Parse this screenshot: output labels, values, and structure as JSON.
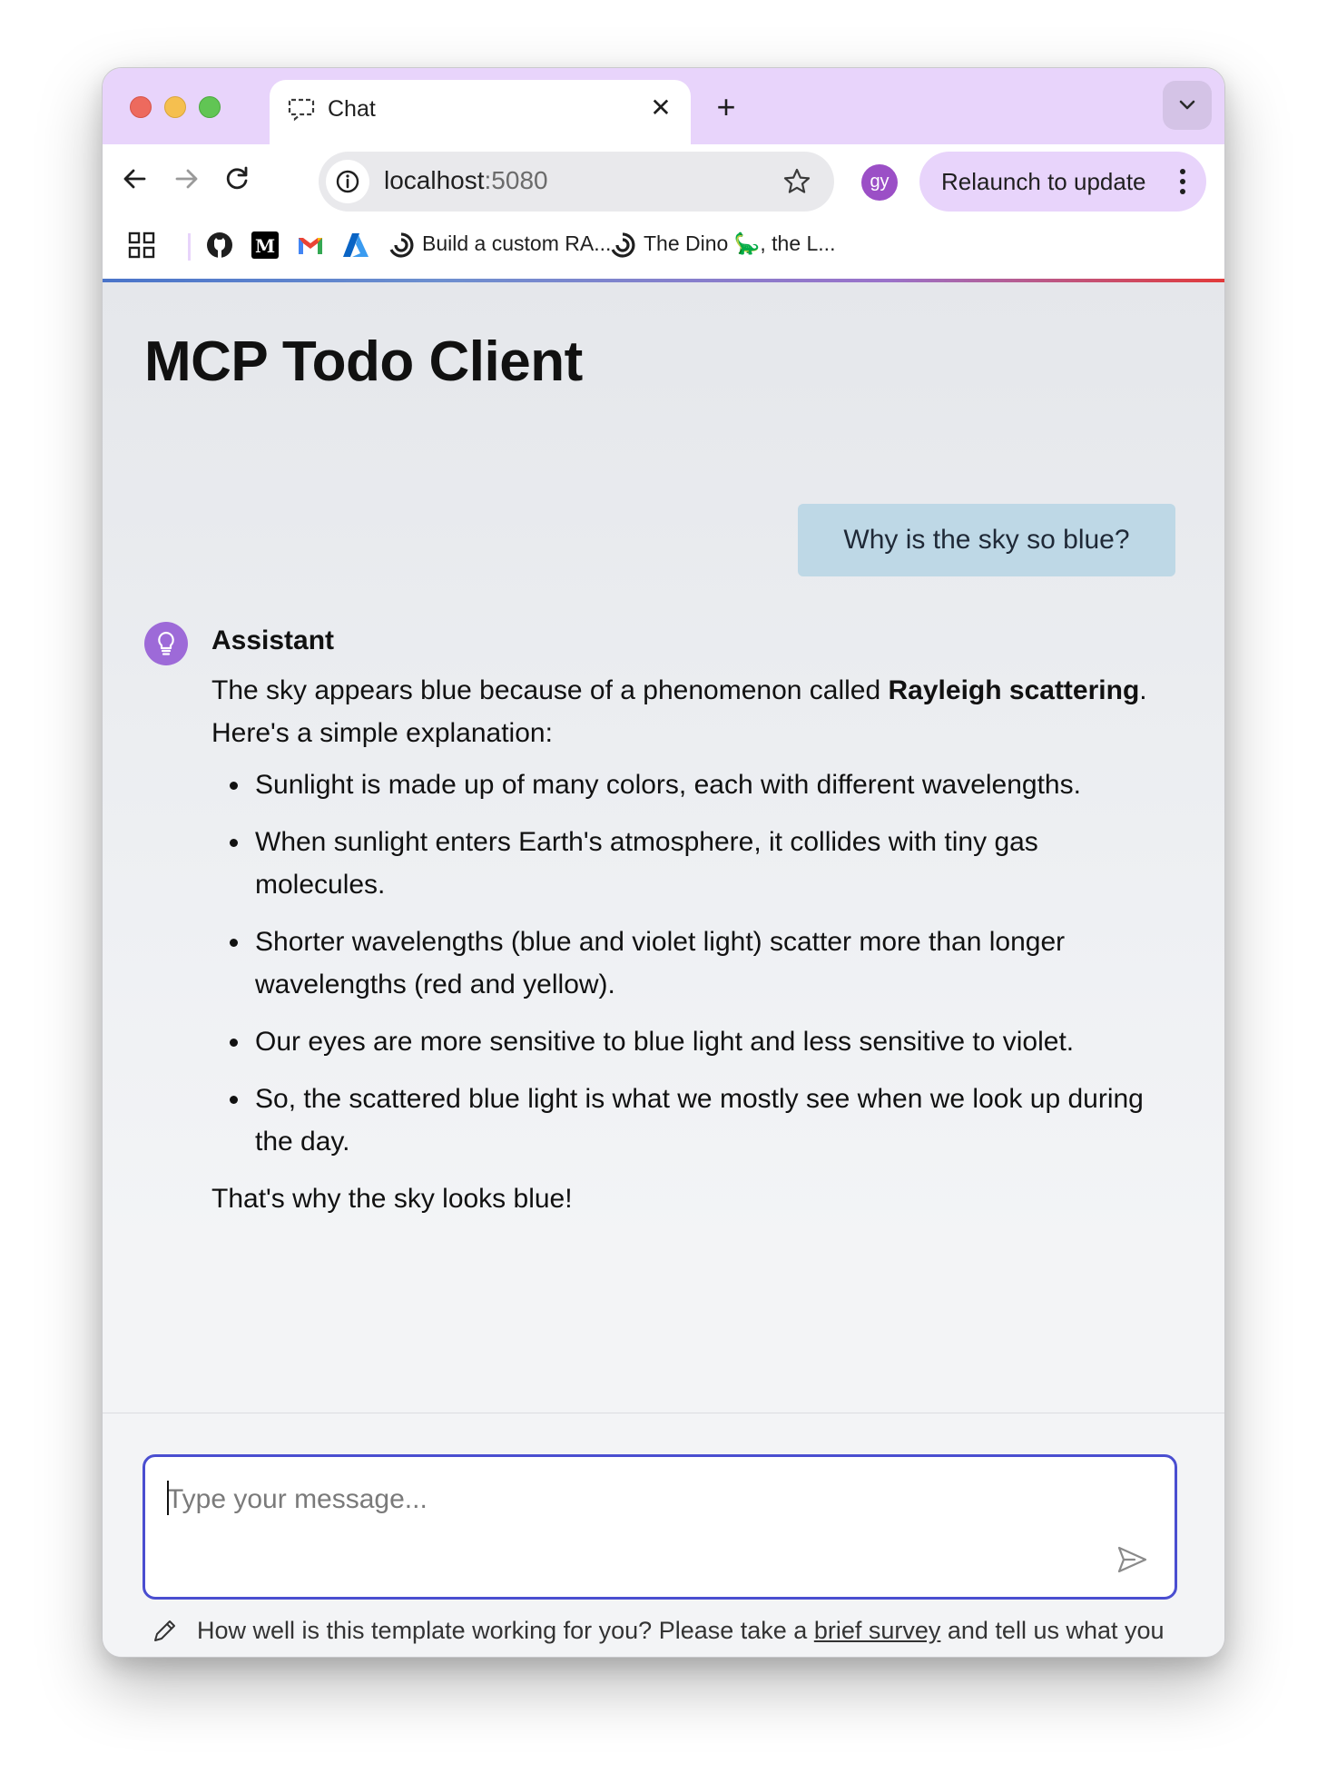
{
  "browser": {
    "tab_title": "Chat",
    "url_host": "localhost",
    "url_port": ":5080",
    "profile_initials": "gy",
    "relaunch_label": "Relaunch to update",
    "bookmarks": [
      {
        "label": "Build a custom RA...",
        "icon": "openai-icon"
      },
      {
        "label": "The Dino 🦕, the L...",
        "icon": "openai-icon"
      }
    ]
  },
  "page": {
    "title": "MCP Todo Client"
  },
  "chat": {
    "user_message": "Why is the sky so blue?",
    "assistant_name": "Assistant",
    "intro_pre": "The sky appears blue because of a phenomenon called ",
    "intro_bold": "Rayleigh scattering",
    "intro_post": ". Here's a simple explanation:",
    "bullets": [
      "Sunlight is made up of many colors, each with different wavelengths.",
      "When sunlight enters Earth's atmosphere, it collides with tiny gas molecules.",
      "Shorter wavelengths (blue and violet light) scatter more than longer wavelengths (red and yellow).",
      "Our eyes are more sensitive to blue light and less sensitive to violet.",
      "So, the scattered blue light is what we mostly see when we look up during the day."
    ],
    "conclusion": "That's why the sky looks blue!"
  },
  "composer": {
    "placeholder": "Type your message...",
    "value": ""
  },
  "survey": {
    "text_pre": "How well is this template working for you? Please take a ",
    "link_text": "brief survey",
    "text_post": " and tell us what you think."
  },
  "colors": {
    "tab_strip": "#e8d4fb",
    "user_bubble": "#bed8e6",
    "assistant_avatar": "#9d6ad8",
    "composer_border": "#4a4ed0"
  }
}
